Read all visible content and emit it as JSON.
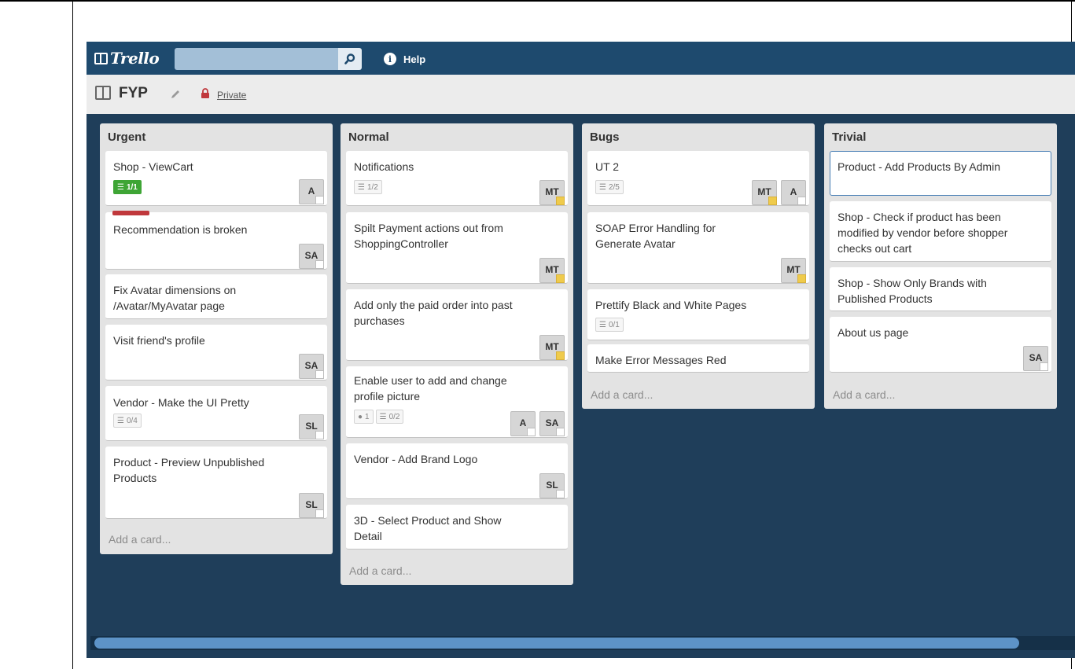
{
  "header": {
    "logo_text": "Trello",
    "search_value": "",
    "search_icon": "search-icon",
    "help_label": "Help"
  },
  "board": {
    "title": "FYP",
    "privacy": "Private"
  },
  "colors": {
    "topbar": "#1e4a6e",
    "board_bg": "#1f3e5a",
    "label_red": "#c0383c",
    "badge_green": "#3ea535",
    "admin_yellow": "#efcb4c"
  },
  "lists": [
    {
      "title": "Urgent",
      "add_card_label": "Add a card...",
      "cards": [
        {
          "title": "Shop - ViewCart",
          "badges": [
            {
              "type": "checklist",
              "text": "1/1",
              "complete": true
            }
          ],
          "members": [
            {
              "initials": "A"
            }
          ]
        },
        {
          "title": "Recommendation is broken",
          "label": "red",
          "members": [
            {
              "initials": "SA"
            }
          ]
        },
        {
          "title": "Fix Avatar dimensions on /Avatar/MyAvatar page"
        },
        {
          "title": "Visit friend's profile",
          "members": [
            {
              "initials": "SA"
            }
          ]
        },
        {
          "title": "Vendor - Make the UI Pretty",
          "badges": [
            {
              "type": "checklist",
              "text": "0/4"
            }
          ],
          "members": [
            {
              "initials": "SL"
            }
          ]
        },
        {
          "title": "Product - Preview Unpublished Products",
          "members": [
            {
              "initials": "SL"
            }
          ]
        }
      ]
    },
    {
      "title": "Normal",
      "add_card_label": "Add a card...",
      "cards": [
        {
          "title": "Notifications",
          "badges": [
            {
              "type": "checklist",
              "text": "1/2"
            }
          ],
          "members": [
            {
              "initials": "MT",
              "admin": true
            }
          ]
        },
        {
          "title": "Spilt Payment actions out from ShoppingController",
          "members": [
            {
              "initials": "MT",
              "admin": true
            }
          ]
        },
        {
          "title": "Add only the paid order into past purchases",
          "members": [
            {
              "initials": "MT",
              "admin": true
            }
          ]
        },
        {
          "title": "Enable user to add and change profile picture",
          "badges": [
            {
              "type": "comment",
              "text": "1"
            },
            {
              "type": "checklist",
              "text": "0/2"
            }
          ],
          "members": [
            {
              "initials": "A"
            },
            {
              "initials": "SA"
            }
          ]
        },
        {
          "title": "Vendor - Add Brand Logo",
          "members": [
            {
              "initials": "SL"
            }
          ]
        },
        {
          "title": "3D - Select Product and Show Detail"
        }
      ]
    },
    {
      "title": "Bugs",
      "add_card_label": "Add a card...",
      "cards": [
        {
          "title": "UT 2",
          "badges": [
            {
              "type": "checklist",
              "text": "2/5"
            }
          ],
          "members": [
            {
              "initials": "MT",
              "admin": true
            },
            {
              "initials": "A"
            }
          ]
        },
        {
          "title": "SOAP Error Handling for Generate Avatar",
          "members": [
            {
              "initials": "MT",
              "admin": true
            }
          ]
        },
        {
          "title": "Prettify Black and White Pages",
          "badges": [
            {
              "type": "checklist",
              "text": "0/1"
            }
          ]
        },
        {
          "title": "Make Error Messages Red"
        }
      ]
    },
    {
      "title": "Trivial",
      "add_card_label": "Add a card...",
      "cards": [
        {
          "title": "Product - Add Products By Admin",
          "selected": true
        },
        {
          "title": "Shop - Check if product has been modified by vendor before shopper checks out cart"
        },
        {
          "title": "Shop - Show Only Brands with Published Products"
        },
        {
          "title": "About us page",
          "members": [
            {
              "initials": "SA"
            }
          ]
        }
      ]
    }
  ]
}
